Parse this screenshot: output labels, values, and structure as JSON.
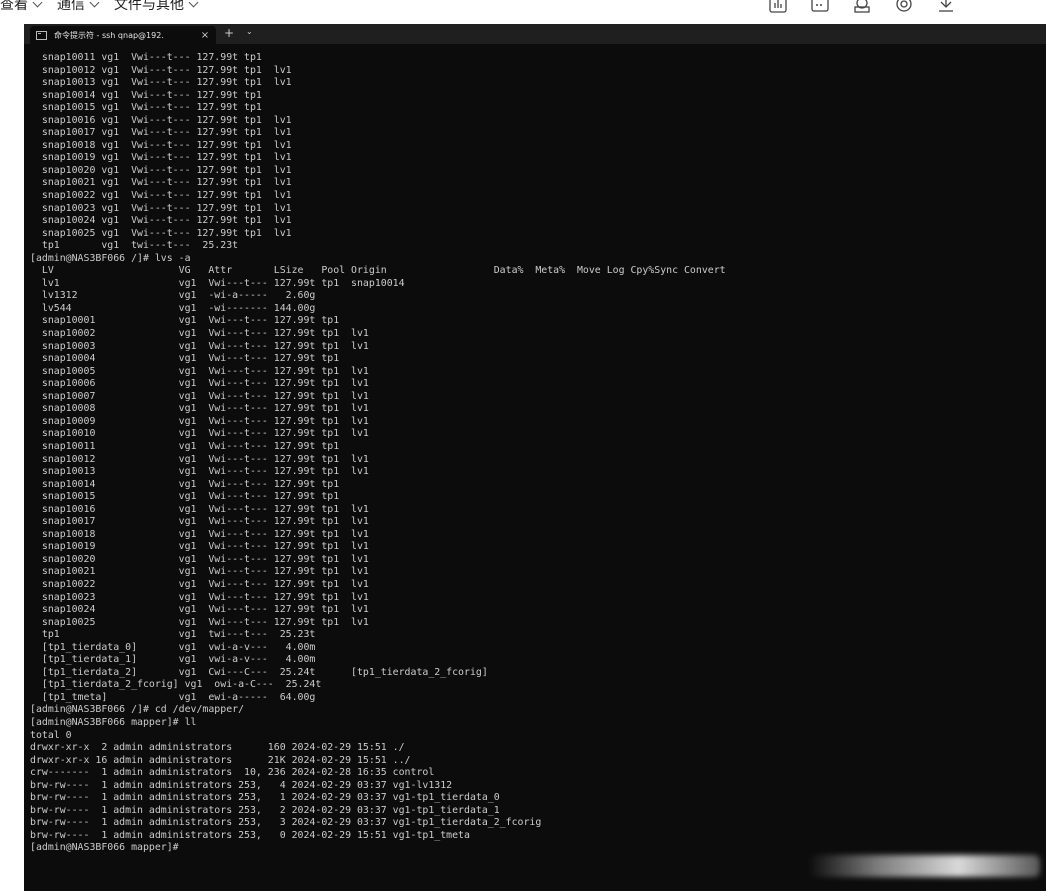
{
  "menu": {
    "items": [
      {
        "label": "查看"
      },
      {
        "label": "通信"
      },
      {
        "label": "文件与其他"
      }
    ]
  },
  "toolbar": {
    "icons": [
      "chart-icon",
      "terminal-icon",
      "user-icon",
      "sync-icon",
      "download-icon"
    ]
  },
  "tab": {
    "title": "命令提示符 - ssh    qnap@192.",
    "close_glyph": "×",
    "new_tab_glyph": "+",
    "dropdown_glyph": "⌄"
  },
  "terminal": {
    "lines": [
      "  snap10011 vg1  Vwi---t--- 127.99t tp1",
      "  snap10012 vg1  Vwi---t--- 127.99t tp1  lv1",
      "  snap10013 vg1  Vwi---t--- 127.99t tp1  lv1",
      "  snap10014 vg1  Vwi---t--- 127.99t tp1",
      "  snap10015 vg1  Vwi---t--- 127.99t tp1",
      "  snap10016 vg1  Vwi---t--- 127.99t tp1  lv1",
      "  snap10017 vg1  Vwi---t--- 127.99t tp1  lv1",
      "  snap10018 vg1  Vwi---t--- 127.99t tp1  lv1",
      "  snap10019 vg1  Vwi---t--- 127.99t tp1  lv1",
      "  snap10020 vg1  Vwi---t--- 127.99t tp1  lv1",
      "  snap10021 vg1  Vwi---t--- 127.99t tp1  lv1",
      "  snap10022 vg1  Vwi---t--- 127.99t tp1  lv1",
      "  snap10023 vg1  Vwi---t--- 127.99t tp1  lv1",
      "  snap10024 vg1  Vwi---t--- 127.99t tp1  lv1",
      "  snap10025 vg1  Vwi---t--- 127.99t tp1  lv1",
      "  tp1       vg1  twi---t---  25.23t",
      "[admin@NAS3BF066 /]# lvs -a",
      "  LV                     VG   Attr       LSize   Pool Origin                  Data%  Meta%  Move Log Cpy%Sync Convert",
      "  lv1                    vg1  Vwi---t--- 127.99t tp1  snap10014",
      "  lv1312                 vg1  -wi-a-----   2.60g",
      "  lv544                  vg1  -wi------- 144.00g",
      "  snap10001              vg1  Vwi---t--- 127.99t tp1",
      "  snap10002              vg1  Vwi---t--- 127.99t tp1  lv1",
      "  snap10003              vg1  Vwi---t--- 127.99t tp1  lv1",
      "  snap10004              vg1  Vwi---t--- 127.99t tp1",
      "  snap10005              vg1  Vwi---t--- 127.99t tp1  lv1",
      "  snap10006              vg1  Vwi---t--- 127.99t tp1  lv1",
      "  snap10007              vg1  Vwi---t--- 127.99t tp1  lv1",
      "  snap10008              vg1  Vwi---t--- 127.99t tp1  lv1",
      "  snap10009              vg1  Vwi---t--- 127.99t tp1  lv1",
      "  snap10010              vg1  Vwi---t--- 127.99t tp1  lv1",
      "  snap10011              vg1  Vwi---t--- 127.99t tp1",
      "  snap10012              vg1  Vwi---t--- 127.99t tp1  lv1",
      "  snap10013              vg1  Vwi---t--- 127.99t tp1  lv1",
      "  snap10014              vg1  Vwi---t--- 127.99t tp1",
      "  snap10015              vg1  Vwi---t--- 127.99t tp1",
      "  snap10016              vg1  Vwi---t--- 127.99t tp1  lv1",
      "  snap10017              vg1  Vwi---t--- 127.99t tp1  lv1",
      "  snap10018              vg1  Vwi---t--- 127.99t tp1  lv1",
      "  snap10019              vg1  Vwi---t--- 127.99t tp1  lv1",
      "  snap10020              vg1  Vwi---t--- 127.99t tp1  lv1",
      "  snap10021              vg1  Vwi---t--- 127.99t tp1  lv1",
      "  snap10022              vg1  Vwi---t--- 127.99t tp1  lv1",
      "  snap10023              vg1  Vwi---t--- 127.99t tp1  lv1",
      "  snap10024              vg1  Vwi---t--- 127.99t tp1  lv1",
      "  snap10025              vg1  Vwi---t--- 127.99t tp1  lv1",
      "  tp1                    vg1  twi---t---  25.23t",
      "  [tp1_tierdata_0]       vg1  vwi-a-v---   4.00m",
      "  [tp1_tierdata_1]       vg1  vwi-a-v---   4.00m",
      "  [tp1_tierdata_2]       vg1  Cwi---C---  25.24t      [tp1_tierdata_2_fcorig]",
      "  [tp1_tierdata_2_fcorig] vg1  owi-a-C---  25.24t",
      "  [tp1_tmeta]            vg1  ewi-a-----  64.00g",
      "[admin@NAS3BF066 /]# cd /dev/mapper/",
      "[admin@NAS3BF066 mapper]# ll",
      "total 0",
      "drwxr-xr-x  2 admin administrators      160 2024-02-29 15:51 ./",
      "drwxr-xr-x 16 admin administrators      21K 2024-02-29 15:51 ../",
      "crw-------  1 admin administrators  10, 236 2024-02-28 16:35 control",
      "brw-rw----  1 admin administrators 253,   4 2024-02-29 03:37 vg1-lv1312",
      "brw-rw----  1 admin administrators 253,   1 2024-02-29 03:37 vg1-tp1_tierdata_0",
      "brw-rw----  1 admin administrators 253,   2 2024-02-29 03:37 vg1-tp1_tierdata_1",
      "brw-rw----  1 admin administrators 253,   3 2024-02-29 03:37 vg1-tp1_tierdata_2_fcorig",
      "brw-rw----  1 admin administrators 253,   0 2024-02-29 15:51 vg1-tp1_tmeta",
      "[admin@NAS3BF066 mapper]#"
    ]
  },
  "colors": {
    "terminal_bg": "#0c0c0c",
    "terminal_fg": "#cccccc",
    "tabbar_bg": "#1f1f1f"
  }
}
